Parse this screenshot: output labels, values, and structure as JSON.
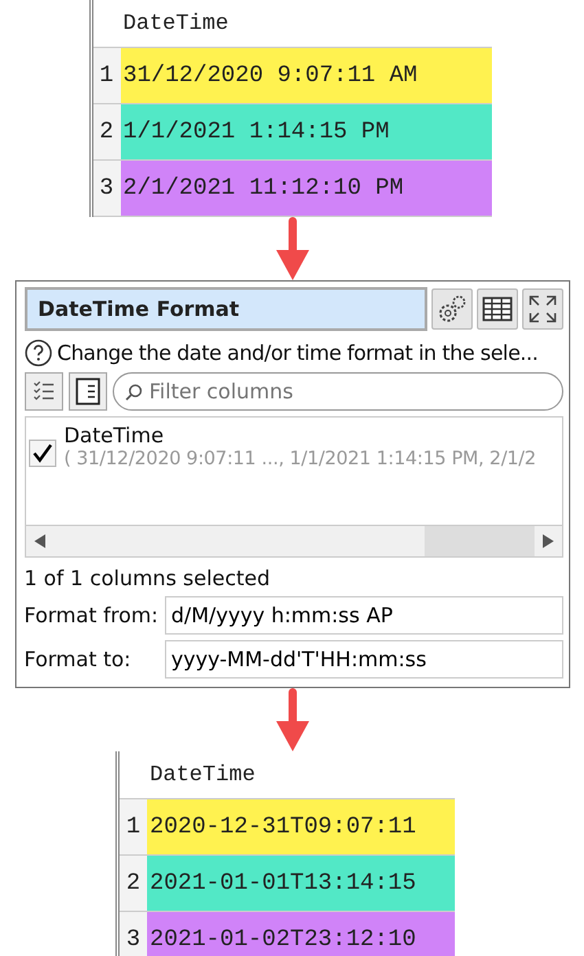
{
  "input_table": {
    "header": "DateTime",
    "rows": [
      {
        "number": "1",
        "value": "31/12/2020 9:07:11 AM",
        "color": "#fff250"
      },
      {
        "number": "2",
        "value": "1/1/2021 1:14:15 PM",
        "color": "#52e8c6"
      },
      {
        "number": "3",
        "value": "2/1/2021 11:12:10 PM",
        "color": "#d083f8"
      }
    ]
  },
  "panel": {
    "title": "DateTime Format",
    "help": "Change the date and/or time format in the sele...",
    "search": {
      "placeholder": "Filter columns"
    },
    "columns": [
      {
        "name": "DateTime",
        "preview": "( 31/12/2020 9:07:11 ..., 1/1/2021 1:14:15 PM, 2/1/2",
        "checked": true
      }
    ],
    "status": "1 of 1 columns selected",
    "fields": [
      {
        "label": "Format from:",
        "value": "d/M/yyyy h:mm:ss AP"
      },
      {
        "label": "Format to:",
        "value": "yyyy-MM-dd'T'HH:mm:ss"
      }
    ]
  },
  "output_table": {
    "header": "DateTime",
    "rows": [
      {
        "number": "1",
        "value": "2020-12-31T09:07:11",
        "color": "#fff250"
      },
      {
        "number": "2",
        "value": "2021-01-01T13:14:15",
        "color": "#52e8c6"
      },
      {
        "number": "3",
        "value": "2021-01-02T23:12:10",
        "color": "#d083f8"
      }
    ]
  }
}
